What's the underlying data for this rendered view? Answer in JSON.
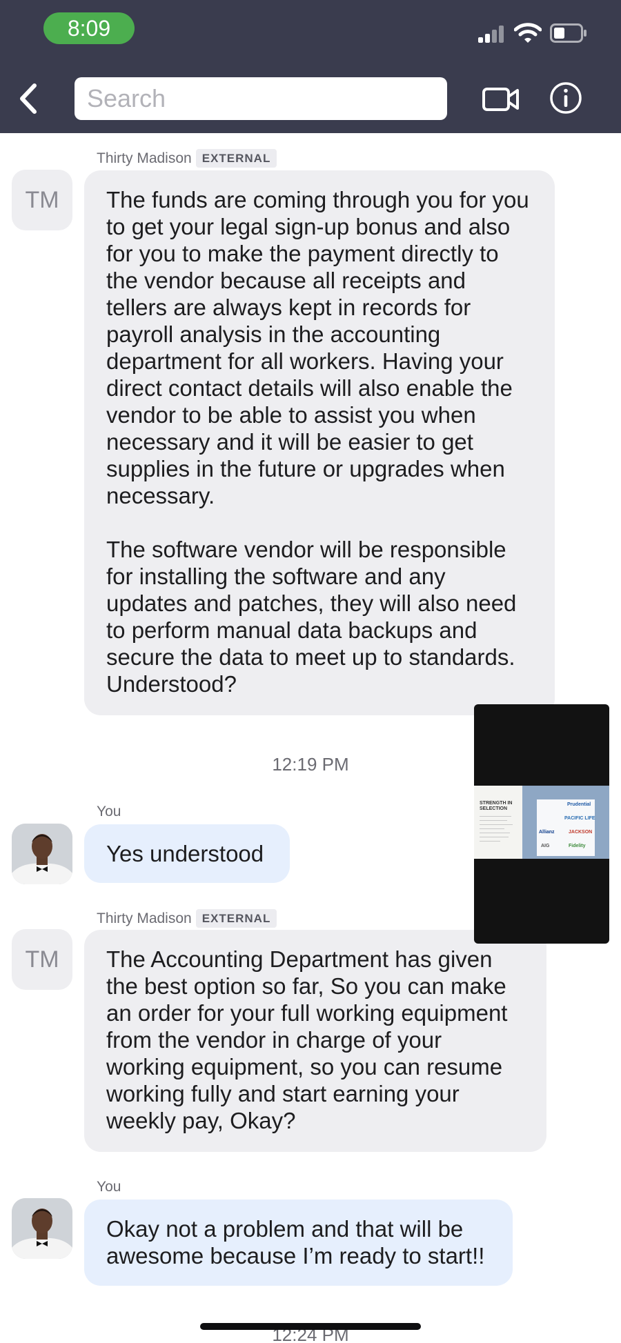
{
  "status_bar": {
    "time": "8:09"
  },
  "header": {
    "search_placeholder": "Search"
  },
  "messages": [
    {
      "sender": "Thirty Madison",
      "badge": "EXTERNAL",
      "avatar_initials": "TM",
      "paragraphs": [
        "The funds are coming through you for you to get your legal sign-up bonus and also for you to make the payment directly to the vendor because all receipts and tellers are always kept in records for payroll analysis in the accounting department for all workers. Having your direct contact details will also enable the vendor to be able to assist you when necessary and it will be easier to get supplies in the future or upgrades when necessary.",
        "The software vendor will be responsible for installing the software and any updates and patches, they will also need to perform manual data backups and secure the data to meet up to standards. Understood?"
      ]
    },
    {
      "timestamp": "12:19 PM"
    },
    {
      "sender": "You",
      "text": "Yes understood"
    },
    {
      "sender": "Thirty Madison",
      "badge": "EXTERNAL",
      "avatar_initials": "TM",
      "text": "The Accounting Department has given the best option so far, So you can make an order for your full working equipment from the vendor in charge of your working equipment, so you can resume working fully and start earning your weekly pay, Okay?"
    },
    {
      "sender": "You",
      "text": "Okay not a problem and that will be awesome because I’m ready to start!!"
    },
    {
      "timestamp": "12:24 PM"
    }
  ],
  "video_preview": {
    "doc_heading": "STRENGTH IN SELECTION",
    "logos": [
      "Prudential",
      "PACIFIC LIFE",
      "Allianz",
      "JACKSON",
      "AIG",
      "Fidelity"
    ]
  },
  "colors": {
    "header_bg": "#3a3c4e",
    "status_time_pill": "#4cae4f",
    "incoming_bubble": "#eeeef1",
    "outgoing_bubble": "#e6effd"
  }
}
